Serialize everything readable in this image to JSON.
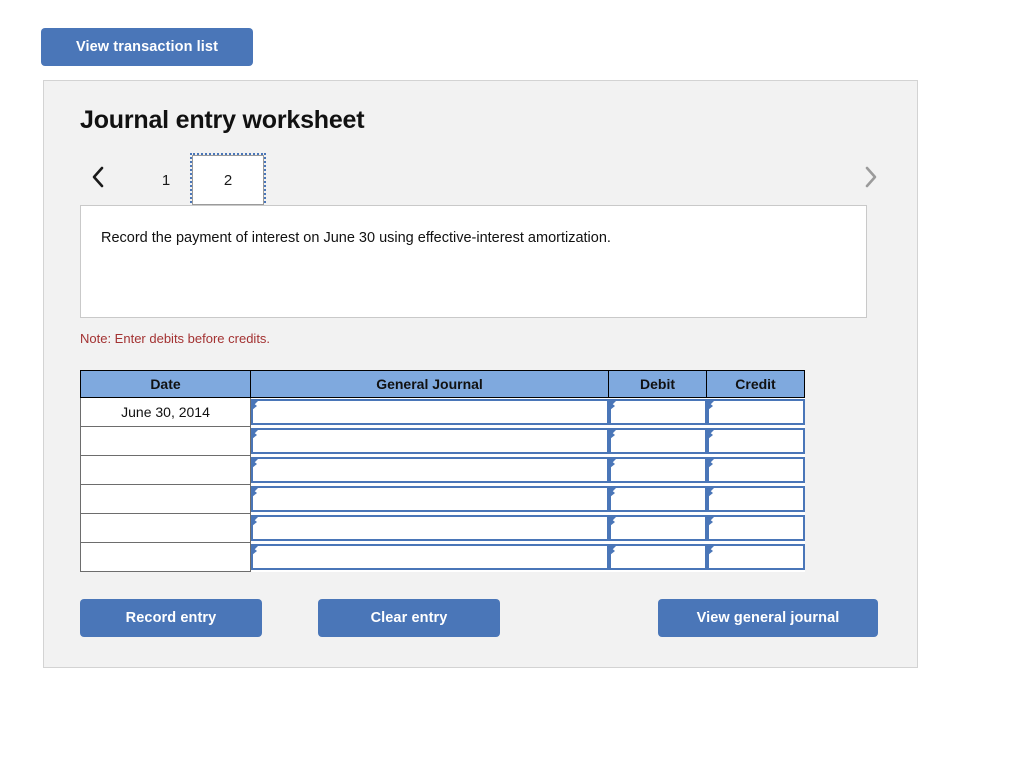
{
  "toolbar": {
    "view_transaction_list": "View transaction list"
  },
  "panel": {
    "title": "Journal entry worksheet"
  },
  "tabs": {
    "prev_icon": "chevron-left-icon",
    "next_icon": "chevron-right-icon",
    "items": [
      {
        "label": "1",
        "active": false
      },
      {
        "label": "2",
        "active": true
      }
    ]
  },
  "description": {
    "text": "Record the payment of interest on June 30 using effective-interest amortization."
  },
  "note": {
    "text": "Note: Enter debits before credits."
  },
  "table": {
    "headers": {
      "date": "Date",
      "general_journal": "General Journal",
      "debit": "Debit",
      "credit": "Credit"
    },
    "rows": [
      {
        "date": "June 30, 2014",
        "general_journal": "",
        "debit": "",
        "credit": ""
      },
      {
        "date": "",
        "general_journal": "",
        "debit": "",
        "credit": ""
      },
      {
        "date": "",
        "general_journal": "",
        "debit": "",
        "credit": ""
      },
      {
        "date": "",
        "general_journal": "",
        "debit": "",
        "credit": ""
      },
      {
        "date": "",
        "general_journal": "",
        "debit": "",
        "credit": ""
      },
      {
        "date": "",
        "general_journal": "",
        "debit": "",
        "credit": ""
      }
    ]
  },
  "actions": {
    "record_entry": "Record entry",
    "clear_entry": "Clear entry",
    "view_general_journal": "View general journal"
  },
  "colors": {
    "button_blue": "#4a76b8",
    "header_blue": "#7fa9de",
    "note_red": "#a33232",
    "panel_gray": "#f2f2f2",
    "panel_border": "#d3d3d3"
  }
}
